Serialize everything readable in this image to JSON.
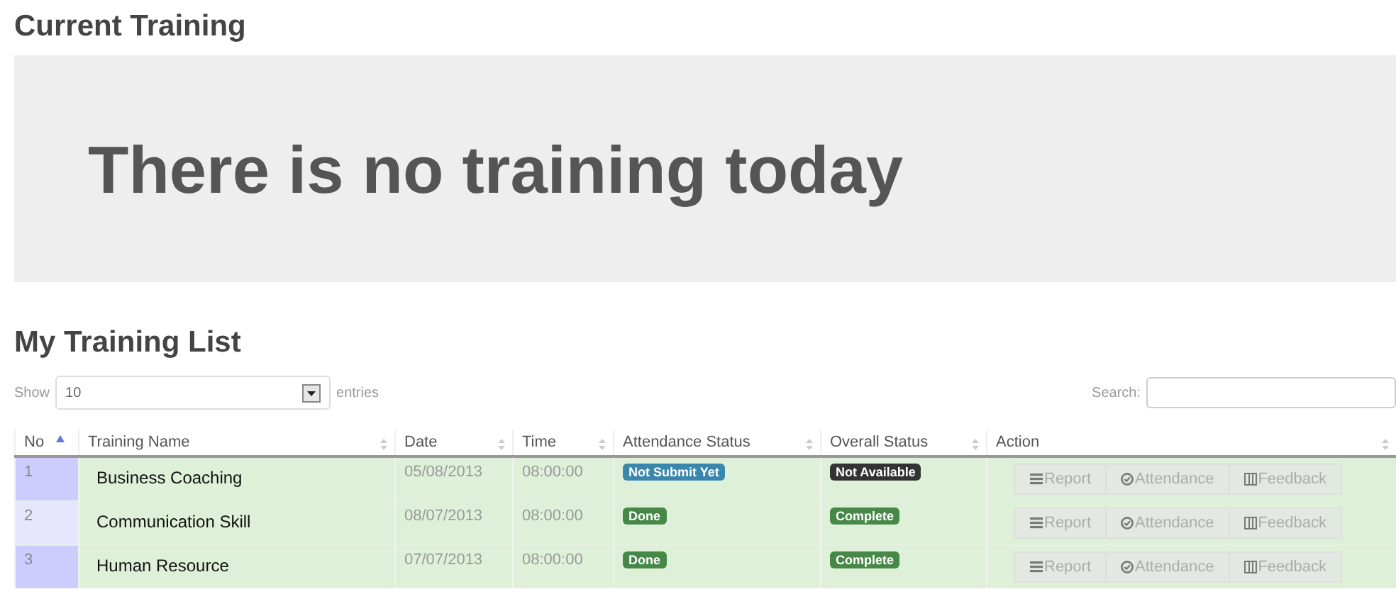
{
  "current": {
    "heading": "Current Training",
    "message": "There is no training today"
  },
  "list": {
    "heading": "My Training List",
    "show_label": "Show",
    "page_size": "10",
    "entries_label": "entries",
    "search_label": "Search:",
    "columns": [
      {
        "label": "No",
        "sorted": true
      },
      {
        "label": "Training Name",
        "sorted": false
      },
      {
        "label": "Date",
        "sorted": false
      },
      {
        "label": "Time",
        "sorted": false
      },
      {
        "label": "Attendance Status",
        "sorted": false
      },
      {
        "label": "Overall Status",
        "sorted": false
      },
      {
        "label": "Action",
        "sorted": false
      }
    ],
    "rows": [
      {
        "no": "1",
        "name": "Business Coaching",
        "date": "05/08/2013",
        "time": "08:00:00",
        "attendance": {
          "text": "Not Submit Yet",
          "color": "#3a87ad"
        },
        "overall": {
          "text": "Not Available",
          "color": "#333333"
        },
        "actions": [
          {
            "kind": "report",
            "label": "Report",
            "disabled": true
          },
          {
            "kind": "attendance",
            "label": "Attendance",
            "disabled": true
          },
          {
            "kind": "feedback",
            "label": "Feedback",
            "disabled": true
          }
        ]
      },
      {
        "no": "2",
        "name": "Communication Skill",
        "date": "08/07/2013",
        "time": "08:00:00",
        "attendance": {
          "text": "Done",
          "color": "#468847"
        },
        "overall": {
          "text": "Complete",
          "color": "#468847"
        },
        "actions": [
          {
            "kind": "report",
            "label": "Report",
            "disabled": true
          },
          {
            "kind": "attendance",
            "label": "Attendance",
            "disabled": true
          },
          {
            "kind": "feedback",
            "label": "Feedback",
            "disabled": true
          }
        ]
      },
      {
        "no": "3",
        "name": "Human Resource",
        "date": "07/07/2013",
        "time": "08:00:00",
        "attendance": {
          "text": "Done",
          "color": "#468847"
        },
        "overall": {
          "text": "Complete",
          "color": "#468847"
        },
        "actions": [
          {
            "kind": "report",
            "label": "Report",
            "disabled": true
          },
          {
            "kind": "attendance",
            "label": "Attendance",
            "disabled": true
          },
          {
            "kind": "feedback",
            "label": "Feedback",
            "disabled": true
          }
        ]
      }
    ]
  }
}
